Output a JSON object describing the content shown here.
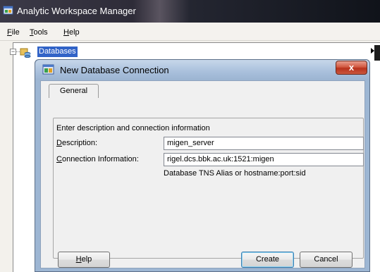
{
  "app": {
    "title": "Analytic Workspace Manager",
    "menu": [
      {
        "mnemonic": "F",
        "rest": "ile"
      },
      {
        "mnemonic": "T",
        "rest": "ools"
      },
      {
        "mnemonic": "H",
        "rest": "elp"
      }
    ],
    "tree": {
      "expander": "−",
      "root_label": "Databases"
    }
  },
  "dialog": {
    "title": "New Database Connection",
    "close_glyph": "x",
    "tab_label": "General",
    "intro_text": "Enter description and connection information",
    "description": {
      "label_mnemonic": "D",
      "label_rest": "escription:",
      "value": "migen_server"
    },
    "connection": {
      "label_mnemonic": "C",
      "label_rest": "onnection Information:",
      "value": "rigel.dcs.bbk.ac.uk:1521:migen",
      "hint": "Database TNS Alias or hostname:port:sid"
    },
    "buttons": {
      "help_mnemonic": "H",
      "help_rest": "elp",
      "create": "Create",
      "cancel": "Cancel"
    }
  },
  "colors": {
    "selection": "#3163c7",
    "dialog_frame": "#9db6d3",
    "close_button": "#c9573f"
  },
  "icons": {
    "app": "workspace-app-icon",
    "tree": "databases-folder-icon",
    "dialog": "workspace-app-icon",
    "close": "close-icon"
  }
}
